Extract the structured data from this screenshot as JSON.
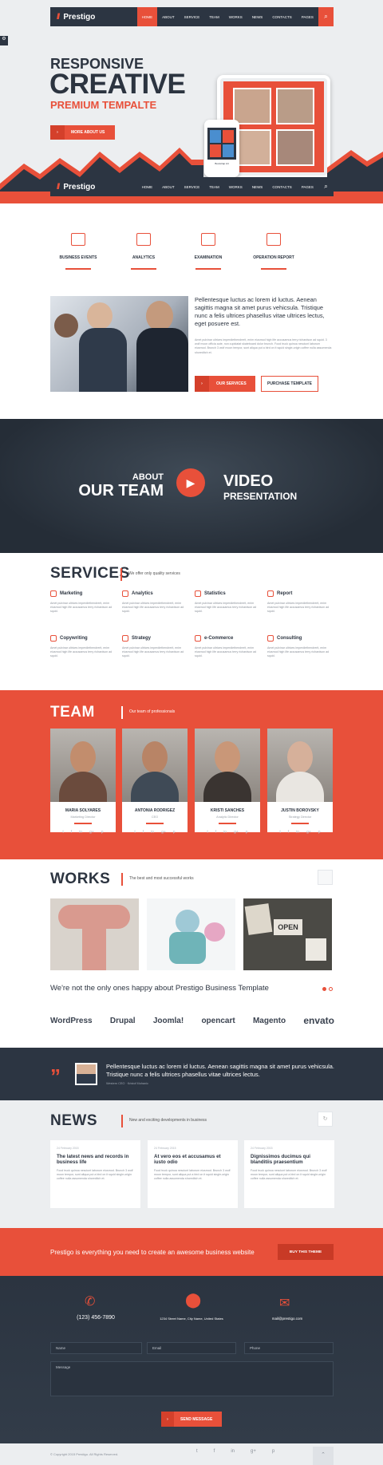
{
  "brand": {
    "name": "Prestigo",
    "logo_mark": "///"
  },
  "nav": {
    "items": [
      "HOME",
      "ABOUT",
      "SERVICE",
      "TEAM",
      "WORKS",
      "NEWS",
      "CONTACTS",
      "PAGES"
    ],
    "active": "HOME",
    "search_icon": "search-icon"
  },
  "nav2": {
    "items": [
      "HOME",
      "ABOUT",
      "SERVICE",
      "TEAM",
      "WORKS",
      "NEWS",
      "CONTACTS",
      "PAGES"
    ]
  },
  "hero": {
    "line1": "RESPONSIVE",
    "line2": "CREATIVE",
    "line3": "PREMIUM TEMPALTE",
    "button": "MORE ABOUT US",
    "device_caption": "Bootstrap Art"
  },
  "features": [
    {
      "label": "BUSINESS EVENTS",
      "icon": "calendar-icon"
    },
    {
      "label": "ANALYTICS",
      "icon": "lightbulb-icon"
    },
    {
      "label": "EXAMINATION",
      "icon": "presentation-icon"
    },
    {
      "label": "OPERATION REPORT",
      "icon": "document-icon"
    }
  ],
  "about": {
    "lead": "Pellentesque luctus ac lorem id luctus. Aenean sagittis magna sit amet purus vehicsula. Tristique nunc a felis ultrices phasellus vitae ultrices lectus, eget posuere est.",
    "body": "Amet pulvinar ultrices imperdiethendrerit, enim eiusmod high life accusamus terry richardson ad squid. 3 wolf moon officia aute, non cupidatat skateboard dolor brunch. Food truck quinoa nesciunt laborum eiusmod. Brunch 3 wolf moon tempor, sunt aliqua put a bird on it squid single-origin coffee nulla assumenda shoreditch et.",
    "btn1": "OUR SERVICES",
    "btn2": "PURCHASE TEMPLATE"
  },
  "video": {
    "about": "ABOUT",
    "our_team": "OUR TEAM",
    "video": "VIDEO",
    "presentation": "PRESENTATION",
    "play_icon": "play-icon"
  },
  "services": {
    "title": "SERVICES",
    "subtitle": "We offer only quality services",
    "items": [
      {
        "name": "Marketing",
        "icon": "chart-icon"
      },
      {
        "name": "Analytics",
        "icon": "pie-icon"
      },
      {
        "name": "Statistics",
        "icon": "presentation-icon"
      },
      {
        "name": "Report",
        "icon": "flag-icon"
      },
      {
        "name": "Copywriting",
        "icon": "pencil-icon"
      },
      {
        "name": "Strategy",
        "icon": "rocket-icon"
      },
      {
        "name": "e-Commerce",
        "icon": "bag-icon"
      },
      {
        "name": "Consulting",
        "icon": "chat-icon"
      }
    ],
    "text": "Amet pulvinar ultrices imperdiethendrerit, enim eiusmod high life accusamus terry richardson ad squid."
  },
  "team": {
    "title": "TEAM",
    "subtitle": "Our team of professionals",
    "members": [
      {
        "name": "MARIA SOLYARES",
        "role": "Marketing Director"
      },
      {
        "name": "ANTONIA RODRIGEZ",
        "role": "CEO"
      },
      {
        "name": "KRISTI SANCHES",
        "role": "Analytic Director"
      },
      {
        "name": "JUSTIN BOROVSKY",
        "role": "Strategy Director"
      }
    ],
    "social": [
      "t",
      "f",
      "in",
      "g+",
      "p"
    ]
  },
  "works": {
    "title": "WORKS",
    "subtitle": "The best and most successful works",
    "open_sign": "OPEN",
    "happy": "We're not the only ones happy about Prestigo Business Template",
    "brands": [
      "WordPress",
      "Drupal",
      "Joomla!",
      "opencart",
      "Magento",
      "envato"
    ]
  },
  "testimonial": {
    "quote": "Pellentesque luctus ac lorem id luctus. Aenean sagittis magna sit amet purus vehicsula. Tristique nunc a felis ultrices phasellus vitae ultrices lectus.",
    "author": "Western CEO · Kristof Mohanic",
    "quote_icon": "quote-icon"
  },
  "news": {
    "title": "NEWS",
    "subtitle": "New and exciting developments in business",
    "items": [
      {
        "date": "24 February 2015",
        "title": "The latest news and records in business life"
      },
      {
        "date": "24 February 2015",
        "title": "At vero eos et accusamus et iusto odio"
      },
      {
        "date": "24 February 2015",
        "title": "Dignissimos ducimus qui blanditiis praesentium"
      }
    ],
    "text": "Food truck quinoa nesciunt laborum eiusmod. Brunch 3 wolf moon tempor, sunt aliqua put a bird on it squid single-origin coffee nulla assumenda shoreditch et."
  },
  "cta": {
    "text": "Prestigo is everything you need to create an awesome business website",
    "button": "BUY THIS THEME"
  },
  "contact": {
    "phone": "(123) 456-7890",
    "address": "1234 Street Name, City Name, United States",
    "email": "mail@prestigo.com",
    "name_ph": "Name",
    "email_ph": "Email",
    "phone_ph": "Phone",
    "message_ph": "Message",
    "send": "SEND MESSAGE"
  },
  "footer": {
    "copyright": "© Copyright 2015 Prestigo. All Rights Reserved."
  },
  "colors": {
    "accent": "#e8503a",
    "dark": "#2c3542"
  }
}
